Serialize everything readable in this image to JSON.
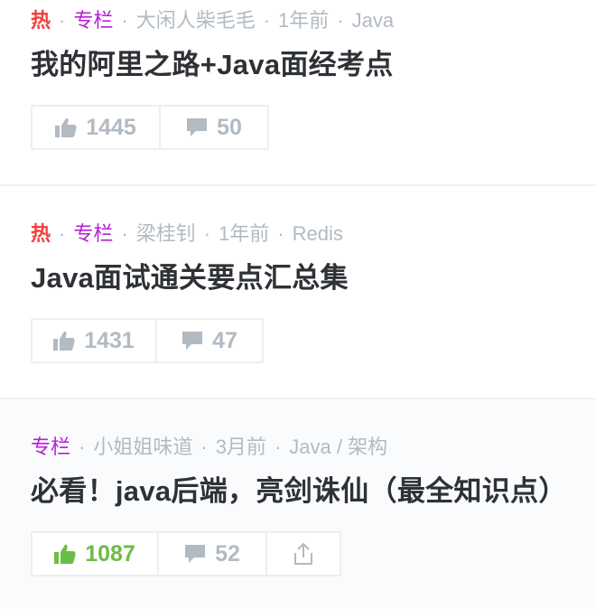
{
  "entries": [
    {
      "hot": "热",
      "column": "专栏",
      "author": "大闲人柴毛毛",
      "time": "1年前",
      "tags": "Java",
      "title": "我的阿里之路+Java面经考点",
      "likes": "1445",
      "comments": "50",
      "liked": false
    },
    {
      "hot": "热",
      "column": "专栏",
      "author": "梁桂钊",
      "time": "1年前",
      "tags": "Redis",
      "title": "Java面试通关要点汇总集",
      "likes": "1431",
      "comments": "47",
      "liked": false
    },
    {
      "column": "专栏",
      "author": "小姐姐味道",
      "time": "3月前",
      "tags": "Java / 架构",
      "title": "必看！java后端，亮剑诛仙（最全知识点）",
      "likes": "1087",
      "comments": "52",
      "liked": true
    }
  ],
  "icons": {
    "like": "thumbs-up-icon",
    "comment": "comment-bubble-icon",
    "share": "share-icon"
  },
  "colors": {
    "hot": "#f1403c",
    "column": "#b71ed7",
    "meta": "#b2bac2",
    "title": "#2e3135",
    "liked": "#6cbd45"
  }
}
